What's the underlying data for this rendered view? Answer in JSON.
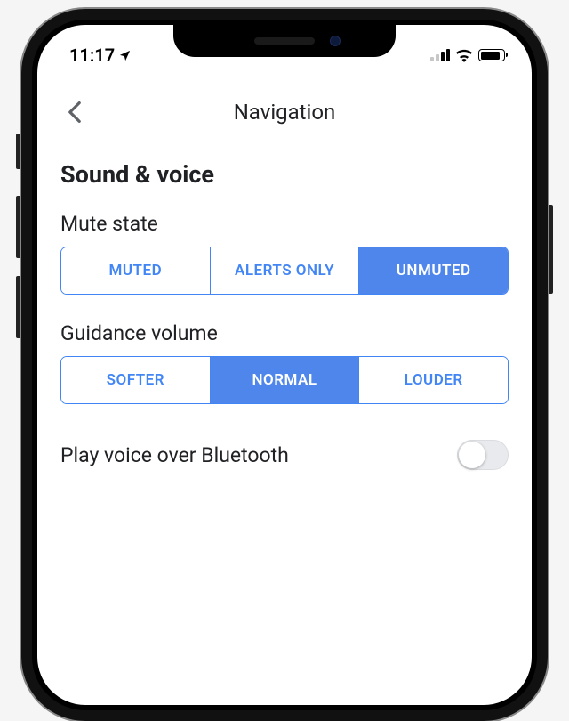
{
  "status": {
    "time": "11:17"
  },
  "header": {
    "title": "Navigation"
  },
  "section": {
    "title": "Sound & voice"
  },
  "mute_state": {
    "label": "Mute state",
    "options": [
      "MUTED",
      "ALERTS ONLY",
      "UNMUTED"
    ],
    "selected": 2
  },
  "guidance_volume": {
    "label": "Guidance volume",
    "options": [
      "SOFTER",
      "NORMAL",
      "LOUDER"
    ],
    "selected": 1
  },
  "bluetooth": {
    "label": "Play voice over Bluetooth",
    "enabled": false
  },
  "colors": {
    "accent": "#4285f4",
    "selected_bg": "#4f86ec"
  }
}
